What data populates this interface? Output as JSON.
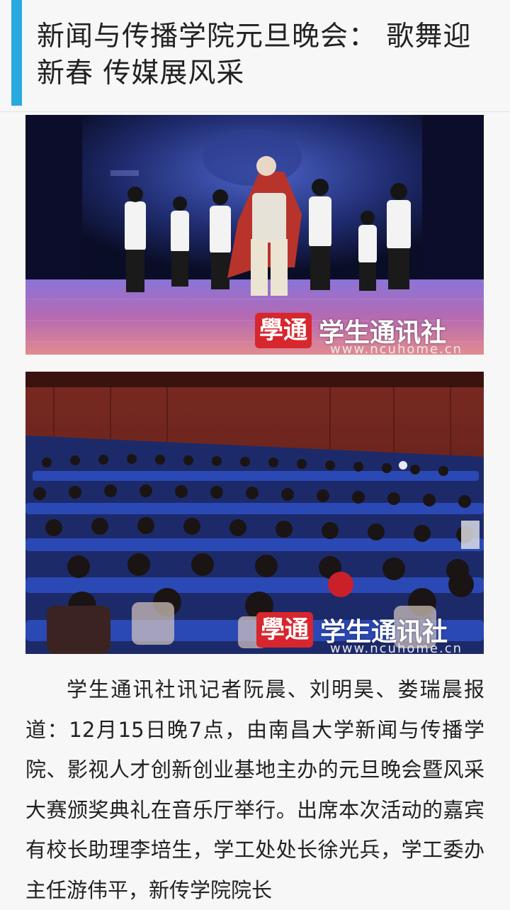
{
  "article": {
    "title": "新闻与传播学院元旦晚会： 歌舞迎新春 传媒展风采",
    "body": "学生通讯社讯记者阮晨、刘明昊、娄瑞晨报道：12月15日晚7点，由南昌大学新闻与传播学院、影视人才创新创业基地主办的元旦晚会暨风采大赛颁奖典礼在音乐厅举行。出席本次活动的嘉宾有校长助理李培生，学工处处长徐光兵，学工委办主任游伟平，新传学院院长"
  },
  "photos": [
    {
      "watermark_logo": "學通",
      "watermark_name": "学生通讯社",
      "watermark_url": "www.ncuhome.cn"
    },
    {
      "watermark_logo": "學通",
      "watermark_name": "学生通讯社",
      "watermark_url": "www.ncuhome.cn"
    }
  ],
  "colors": {
    "accent": "#2aa9e0",
    "watermark_red": "#d8262e"
  }
}
